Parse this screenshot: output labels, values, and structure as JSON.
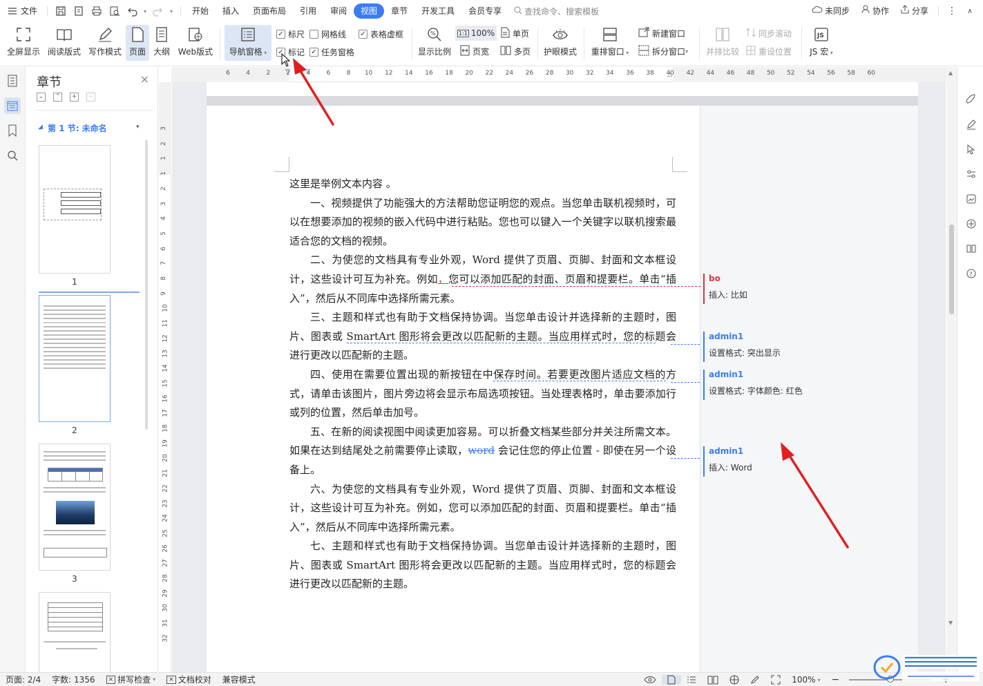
{
  "menubar": {
    "file_label": "文件",
    "tabs": [
      "开始",
      "插入",
      "页面布局",
      "引用",
      "审阅",
      "视图",
      "章节",
      "开发工具",
      "会员专享"
    ],
    "active_tab": "视图",
    "search_placeholder": "查找命令、搜索模板",
    "sync_label": "未同步",
    "collab_label": "协作",
    "share_label": "分享"
  },
  "ribbon": {
    "fullscreen": "全屏显示",
    "read_mode": "阅读版式",
    "write_mode": "写作模式",
    "page": "页面",
    "outline": "大纲",
    "web": "Web版式",
    "nav_pane": "导航窗格",
    "ruler": "标尺",
    "gridlines": "网格线",
    "table_gridlines": "表格虚框",
    "markup": "标记",
    "task_pane": "任务窗格",
    "zoom_label": "显示比例",
    "zoom_100": "100%",
    "single_page": "单页",
    "page_width": "页宽",
    "multi_page": "多页",
    "eye_mode": "护眼模式",
    "rearrange": "重排窗口",
    "new_window": "新建窗口",
    "split_window": "拆分窗口",
    "side_by_side": "并排比较",
    "sync_scroll": "同步滚动",
    "reset_position": "重设位置",
    "js_macro": "JS 宏"
  },
  "chapter_panel": {
    "title": "章节",
    "section": "第 1 节: 未命名",
    "pages": [
      "1",
      "2",
      "3"
    ]
  },
  "ruler": {
    "h_ticks": [
      "6",
      "4",
      "2",
      "2",
      "4",
      "6",
      "8",
      "10",
      "12",
      "14",
      "16",
      "18",
      "20",
      "22",
      "24",
      "26",
      "28",
      "30",
      "32",
      "34",
      "36",
      "38",
      "40",
      "42",
      "44",
      "46",
      "48",
      "50",
      "52",
      "54",
      "56",
      "58",
      "60"
    ],
    "v_ticks": [
      "3",
      "2",
      "1",
      "1",
      "2",
      "3",
      "4",
      "5",
      "6",
      "7",
      "8",
      "9",
      "10",
      "11",
      "12",
      "13",
      "14",
      "15",
      "16",
      "17",
      "18",
      "19",
      "20",
      "21",
      "22",
      "23",
      "24",
      "25",
      "26",
      "27",
      "28",
      "29",
      "30",
      "31",
      "32"
    ]
  },
  "document": {
    "p0": "这里是举例文本内容 。",
    "p1": "一、视频提供了功能强大的方法帮助您证明您的观点。当您单击联机视频时，可以在想要添加的视频的嵌入代码中进行粘贴。您也可以键入一个关键字以联机搜索最适合您的文档的视频。",
    "p2_a": "二、为使您的文档具有专业外观，Word 提供了页眉、页脚、封面和文本框设计，这些设计可互为补充。例如",
    "p2_ins": "，",
    "p2_b": "您可以添加匹配的封面、页眉和提要栏。单击“插入”，然后从不同库中选择所需元素。",
    "p3_a": "三、主题和样式也有助于文档保持协调。当您单击设计并选择新的主题时，图片、图表或 ",
    "p3_hl": "SmartArt 图形将会更改以匹配新的主题。当应用样式时，您的标",
    "p3_b": "题会进行更改以匹配新的主题。",
    "p4_a": "四、使用在需要位置出现的新按钮在中",
    "p4_hl": "保存时间。若要更改图片适应文档的",
    "p4_b": "方式，请单击该图片，图片旁边将会显示布局选项按钮。当处理表格时，单击要添加行或列的位置，然后单击加号。",
    "p5_a": "五、在新的阅读视图中阅读更加容易。可以折叠文档某些部分并关注所需文本。如果在达到结尾处之前需要停止读取，",
    "p5_word": "word",
    "p5_b": " 会记住您的停止位置 - 即使在另一个设备上。",
    "p6": "六、为使您的文档具有专业外观，Word 提供了页眉、页脚、封面和文本框设计，这些设计可互为补充。例如，您可以添加匹配的封面、页眉和提要栏。单击“插入”，然后从不同库中选择所需元素。",
    "p7": "七、主题和样式也有助于文档保持协调。当您单击设计并选择新的主题时，图片、图表或 SmartArt 图形将会更改以匹配新的主题。当应用样式时，您的标题会进行更改以匹配新的主题。"
  },
  "comments": [
    {
      "author": "bo",
      "text": "插入: 比如",
      "color": "#d9363e"
    },
    {
      "author": "admin1",
      "text": "设置格式: 突出显示",
      "color": "#3b7cf3"
    },
    {
      "author": "admin1",
      "text": "设置格式: 字体颜色: 红色",
      "color": "#3b7cf3"
    },
    {
      "author": "admin1",
      "text": "插入: Word",
      "color": "#3b7cf3"
    }
  ],
  "statusbar": {
    "page": "页面: 2/4",
    "words": "字数: 1356",
    "spell": "拼写检查",
    "proof": "文档校对",
    "compat": "兼容模式",
    "zoom": "100%"
  },
  "colors": {
    "accent": "#3b7cf3",
    "revision_red": "#d9363e",
    "arrow_red": "#e02020"
  }
}
